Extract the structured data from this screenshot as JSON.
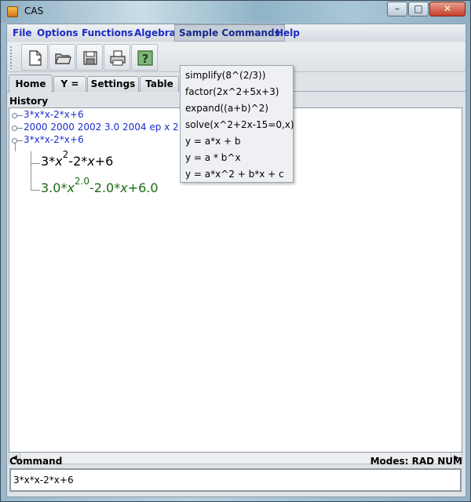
{
  "window": {
    "title": "CAS",
    "minimize": "–",
    "maximize": "□",
    "close": "✕"
  },
  "menubar": {
    "file": "File",
    "options": "Options",
    "functions": "Functions",
    "algebra": "Algebra",
    "sample_commands": "Sample Commands",
    "help": "Help"
  },
  "toolbar": {
    "buttons": [
      "new-file-icon",
      "open-folder-icon",
      "save-disk-icon",
      "print-icon",
      "help-icon"
    ]
  },
  "tabs": {
    "home": "Home",
    "y": "Y =",
    "settings": "Settings",
    "table": "Table"
  },
  "history": {
    "label": "History",
    "items": [
      "3*x*x-2*x+6",
      "2000 2000 2002 3.0 2004 ep x 2.0",
      "3*x*x-2*x+6"
    ],
    "result_input": {
      "coef": "3",
      "var1": "x",
      "exp": "2",
      "rest_op1": "-2",
      "var2": "x",
      "rest_op2": "+6",
      "times1": "*",
      "times2": "*"
    },
    "result_output": {
      "coef": "3.0",
      "var1": "x",
      "exp": "2.0",
      "rest_op1": "-2.0",
      "var2": "x",
      "rest_op2": "+6.0",
      "times1": "*",
      "times2": "*"
    }
  },
  "command": {
    "label": "Command",
    "modes": "Modes: RAD NUM",
    "value": "3*x*x-2*x+6"
  },
  "sample_commands_menu": [
    "simplify(8^(2/3))",
    "factor(2x^2+5x+3)",
    "expand((a+b)^2)",
    "solve(x^2+2x-15=0,x)",
    "y = a*x + b",
    "y = a * b^x",
    "y = a*x^2 + b*x + c"
  ],
  "colors": {
    "menu_text": "#1c2bc2",
    "history_text": "#1a2dcb",
    "result_green": "#1a6a14"
  }
}
